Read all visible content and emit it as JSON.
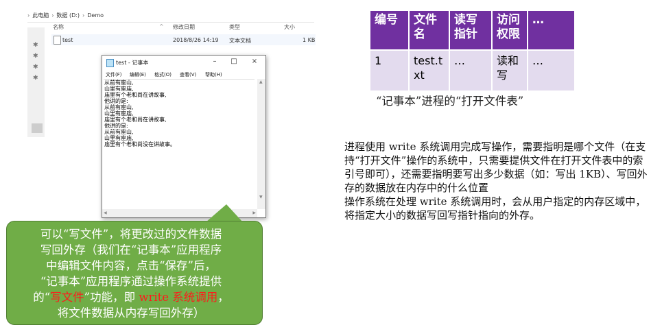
{
  "explorer": {
    "breadcrumb": [
      "此电脑",
      "数据 (D:)",
      "Demo"
    ],
    "columns": {
      "name": "名称",
      "date": "修改日期",
      "type": "类型",
      "size": "大小"
    },
    "file": {
      "name": "test",
      "date": "2018/8/26 14:19",
      "type": "文本文档",
      "size": "1 KB"
    }
  },
  "notepad": {
    "title": "test - 记事本",
    "controls": {
      "minimize": "–",
      "maximize": "□",
      "close": "×"
    },
    "menu": [
      "文件(F)",
      "编辑(E)",
      "格式(O)",
      "查看(V)",
      "帮助(H)"
    ],
    "lines": [
      "从前有座山,",
      "山里有座庙,",
      "庙里有个老和尚在讲故事,",
      "他讲的是:",
      "从前有座山,",
      "山里有座庙,",
      "庙里有个老和尚在讲故事,",
      "他讲的是:",
      "从前有座山,",
      "山里有座庙,",
      "庙里有个老和尚没在讲故事。"
    ]
  },
  "callout": {
    "line1": "可以“写文件”，将更改过的文件数据",
    "line2": "写回外存（我们在“记事本”应用程序",
    "line3": "中编辑文件内容，点击“保存”后，",
    "line4": "“记事本”应用程序通过操作系统提供",
    "line5_a": "的“",
    "line5_b": "写文件",
    "line5_c": "”功能，即 ",
    "line5_d": "write 系统调用",
    "line5_e": "，",
    "line6": "将文件数据从内存写回外存）",
    "colors": {
      "background": "#70ad47",
      "highlight": "#ff1a1a"
    }
  },
  "table": {
    "headers": [
      "编号",
      "文件名",
      "读写指针",
      "访问权限",
      "…"
    ],
    "row": [
      "1",
      "test.txt",
      "…",
      "读和写",
      "…"
    ],
    "colors": {
      "header": "#7030a0",
      "cell": "#e3dbee"
    }
  },
  "caption": "“记事本”进程的“打开文件表”",
  "description": {
    "para1": "进程使用 write 系统调用完成写操作，需要指明是哪个文件（在支持“打开文件”操作的系统中，只需要提供文件在打开文件表中的索引号即可），还需要指明要写出多少数据（如：写出 1KB）、写回外存的数据放在内存中的什么位置",
    "para2": "操作系统在处理 write 系统调用时，会从用户指定的内存区域中，将指定大小的数据写回写指针指向的外存。"
  }
}
